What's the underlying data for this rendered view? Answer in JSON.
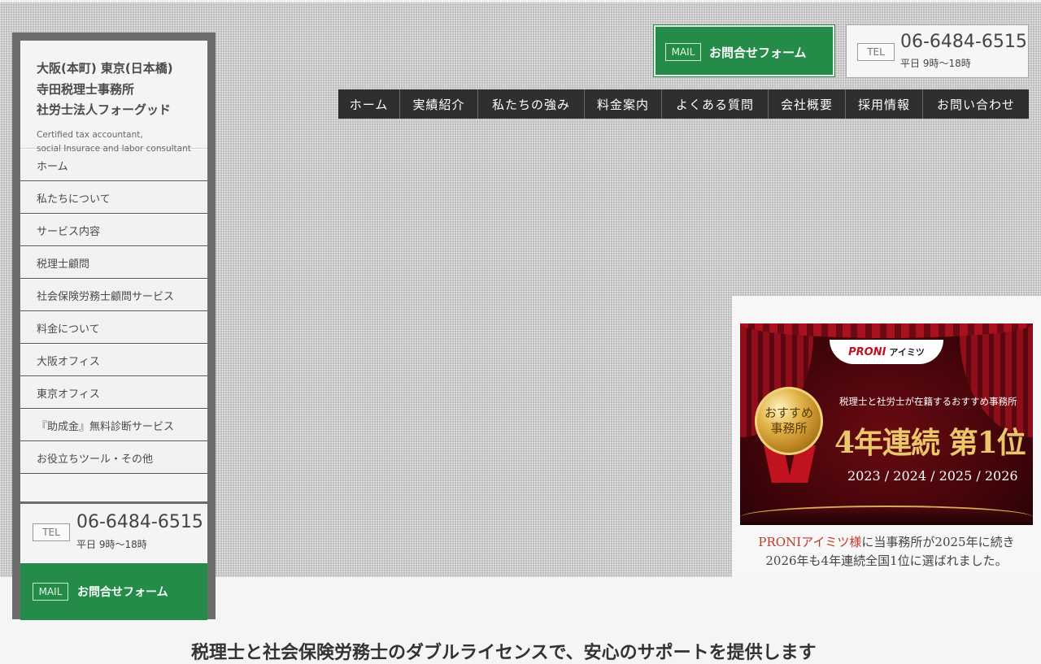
{
  "sidebar": {
    "brand_lines": [
      "大阪(本町) 東京(日本橋)",
      "寺田税理士事務所",
      "社労士法人フォーグッド"
    ],
    "brand_en": [
      "Certified tax accountant,",
      "social Insurace and labor consultant"
    ],
    "items": [
      {
        "label": "ホーム"
      },
      {
        "label": "私たちについて"
      },
      {
        "label": "サービス内容"
      },
      {
        "label": "税理士顧問"
      },
      {
        "label": "社会保険労務士顧問サービス"
      },
      {
        "label": "料金について"
      },
      {
        "label": "大阪オフィス"
      },
      {
        "label": "東京オフィス"
      },
      {
        "label": "『助成金』無料診断サービス"
      },
      {
        "label": "お役立ちツール・その他"
      }
    ],
    "tel": {
      "badge": "TEL",
      "number": "06-6484-6515",
      "hours": "平日 9時〜18時"
    },
    "mail": {
      "badge": "MAIL",
      "label": "お問合せフォーム"
    }
  },
  "header": {
    "mail": {
      "badge": "MAIL",
      "label": "お問合せフォーム"
    },
    "tel": {
      "badge": "TEL",
      "number": "06-6484-6515",
      "hours": "平日 9時〜18時"
    }
  },
  "global_nav": [
    {
      "label": "ホーム"
    },
    {
      "label": "実績紹介"
    },
    {
      "label": "私たちの強み"
    },
    {
      "label": "料金案内"
    },
    {
      "label": "よくある質問"
    },
    {
      "label": "会社概要"
    },
    {
      "label": "採用情報"
    },
    {
      "label": "お問い合わせ"
    }
  ],
  "award": {
    "logo": "PRONI",
    "logo_suffix": "アイミツ",
    "medal_text": [
      "おすすめ",
      "事務所"
    ],
    "subtitle": "税理士と社労士が在籍するおすすめ事務所",
    "main": "4年連続 第1位",
    "years": "2023 / 2024 / 2025 / 2026",
    "caption_highlight": "PRONIアイミツ様",
    "caption_rest": "に当事務所が2025年に続き",
    "caption_line2": "2026年も4年連続全国1位に選ばれました。"
  },
  "main": {
    "heading": "税理士と社会保険労務士のダブルライセンスで、安心のサポートを提供します"
  },
  "colors": {
    "green": "#248c48",
    "nav_dark": "#2f2f2f",
    "highlight_red": "#c0392b"
  }
}
